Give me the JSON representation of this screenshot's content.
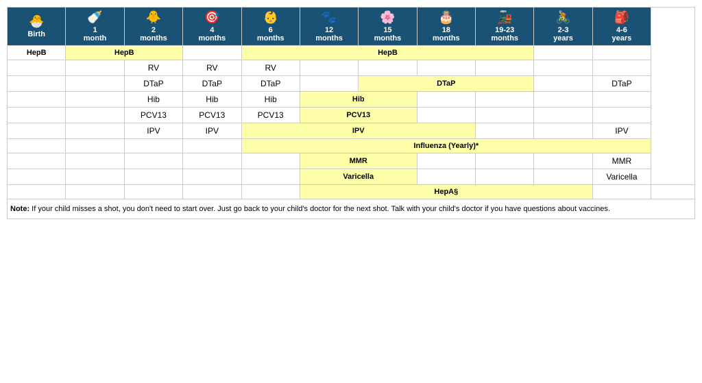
{
  "headers": [
    {
      "id": "birth",
      "label": "Birth",
      "sublabel": "",
      "icon": "🐣"
    },
    {
      "id": "1m",
      "label": "1",
      "sublabel": "month",
      "icon": "🍼"
    },
    {
      "id": "2m",
      "label": "2",
      "sublabel": "months",
      "icon": "🐥"
    },
    {
      "id": "4m",
      "label": "4",
      "sublabel": "months",
      "icon": "🎯"
    },
    {
      "id": "6m",
      "label": "6",
      "sublabel": "months",
      "icon": "👶"
    },
    {
      "id": "12m",
      "label": "12",
      "sublabel": "months",
      "icon": "🐾"
    },
    {
      "id": "15m",
      "label": "15",
      "sublabel": "months",
      "icon": "🌸"
    },
    {
      "id": "18m",
      "label": "18",
      "sublabel": "months",
      "icon": "🎂"
    },
    {
      "id": "19-23m",
      "label": "19-23",
      "sublabel": "months",
      "icon": "🚂"
    },
    {
      "id": "2-3y",
      "label": "2-3",
      "sublabel": "years",
      "icon": "🚴"
    },
    {
      "id": "4-6y",
      "label": "4-6",
      "sublabel": "years",
      "icon": "🎒"
    }
  ],
  "vaccines": [
    {
      "name": "HepB",
      "cells": [
        "yellow",
        "yellow",
        "empty",
        "empty",
        "yellow-span6",
        "empty",
        "empty"
      ]
    }
  ],
  "note": {
    "bold": "Note:",
    "text": " If your child misses a shot, you don't need to start over. Just go back to your child's doctor for the next shot. Talk with your child's doctor if you have questions about vaccines."
  },
  "rows": [
    {
      "label": "HepB",
      "cells": [
        {
          "col": "birth",
          "type": "label",
          "text": "HepB"
        },
        {
          "col": "1m",
          "type": "yellow",
          "text": "HepB",
          "colspan": 2
        },
        {
          "col": "4m",
          "type": "empty",
          "text": ""
        },
        {
          "col": "6m",
          "type": "yellow",
          "text": "HepB",
          "colspan": 5
        },
        {
          "col": "19-23m",
          "type": "empty",
          "text": ""
        },
        {
          "col": "2-3y",
          "type": "empty",
          "text": ""
        },
        {
          "col": "4-6y",
          "type": "empty",
          "text": ""
        }
      ]
    },
    {
      "label": "RV",
      "cells": [
        {
          "col": "birth",
          "type": "empty",
          "text": ""
        },
        {
          "col": "1m",
          "type": "empty",
          "text": ""
        },
        {
          "col": "2m",
          "type": "label-cell",
          "text": "RV"
        },
        {
          "col": "4m",
          "type": "label-cell",
          "text": "RV"
        },
        {
          "col": "6m",
          "type": "label-cell",
          "text": "RV"
        },
        {
          "col": "12m",
          "type": "empty",
          "text": ""
        },
        {
          "col": "15m",
          "type": "empty",
          "text": ""
        },
        {
          "col": "18m",
          "type": "empty",
          "text": ""
        },
        {
          "col": "19-23m",
          "type": "empty",
          "text": ""
        },
        {
          "col": "2-3y",
          "type": "empty",
          "text": ""
        },
        {
          "col": "4-6y",
          "type": "empty",
          "text": ""
        }
      ]
    },
    {
      "label": "DTaP",
      "cells": [
        {
          "col": "birth",
          "type": "empty",
          "text": ""
        },
        {
          "col": "1m",
          "type": "empty",
          "text": ""
        },
        {
          "col": "2m",
          "type": "label-cell",
          "text": "DTaP"
        },
        {
          "col": "4m",
          "type": "label-cell",
          "text": "DTaP"
        },
        {
          "col": "6m",
          "type": "label-cell",
          "text": "DTaP"
        },
        {
          "col": "12m",
          "type": "empty",
          "text": ""
        },
        {
          "col": "15m",
          "type": "yellow",
          "text": "DTaP",
          "colspan": 3
        },
        {
          "col": "19-23m",
          "type": "empty",
          "text": ""
        },
        {
          "col": "2-3y",
          "type": "empty",
          "text": ""
        },
        {
          "col": "4-6y",
          "type": "label-cell",
          "text": "DTaP"
        }
      ]
    },
    {
      "label": "Hib",
      "cells": [
        {
          "col": "birth",
          "type": "empty",
          "text": ""
        },
        {
          "col": "1m",
          "type": "empty",
          "text": ""
        },
        {
          "col": "2m",
          "type": "label-cell",
          "text": "Hib"
        },
        {
          "col": "4m",
          "type": "label-cell",
          "text": "Hib"
        },
        {
          "col": "6m",
          "type": "label-cell",
          "text": "Hib"
        },
        {
          "col": "12m",
          "type": "yellow",
          "text": "Hib",
          "colspan": 2
        },
        {
          "col": "18m",
          "type": "empty",
          "text": ""
        },
        {
          "col": "19-23m",
          "type": "empty",
          "text": ""
        },
        {
          "col": "2-3y",
          "type": "empty",
          "text": ""
        },
        {
          "col": "4-6y",
          "type": "empty",
          "text": ""
        }
      ]
    },
    {
      "label": "PCV13",
      "cells": [
        {
          "col": "birth",
          "type": "empty",
          "text": ""
        },
        {
          "col": "1m",
          "type": "empty",
          "text": ""
        },
        {
          "col": "2m",
          "type": "label-cell",
          "text": "PCV13"
        },
        {
          "col": "4m",
          "type": "label-cell",
          "text": "PCV13"
        },
        {
          "col": "6m",
          "type": "label-cell",
          "text": "PCV13"
        },
        {
          "col": "12m",
          "type": "yellow",
          "text": "PCV13",
          "colspan": 2
        },
        {
          "col": "18m",
          "type": "empty",
          "text": ""
        },
        {
          "col": "19-23m",
          "type": "empty",
          "text": ""
        },
        {
          "col": "2-3y",
          "type": "empty",
          "text": ""
        },
        {
          "col": "4-6y",
          "type": "empty",
          "text": ""
        }
      ]
    },
    {
      "label": "IPV",
      "cells": [
        {
          "col": "birth",
          "type": "empty",
          "text": ""
        },
        {
          "col": "1m",
          "type": "empty",
          "text": ""
        },
        {
          "col": "2m",
          "type": "label-cell",
          "text": "IPV"
        },
        {
          "col": "4m",
          "type": "label-cell",
          "text": "IPV"
        },
        {
          "col": "6m",
          "type": "yellow",
          "text": "IPV",
          "colspan": 4
        },
        {
          "col": "19-23m",
          "type": "empty",
          "text": ""
        },
        {
          "col": "2-3y",
          "type": "empty",
          "text": ""
        },
        {
          "col": "4-6y",
          "type": "label-cell",
          "text": "IPV"
        }
      ]
    },
    {
      "label": "Influenza",
      "cells": [
        {
          "col": "birth",
          "type": "empty",
          "text": ""
        },
        {
          "col": "1m",
          "type": "empty",
          "text": ""
        },
        {
          "col": "2m",
          "type": "empty",
          "text": ""
        },
        {
          "col": "4m",
          "type": "empty",
          "text": ""
        },
        {
          "col": "6m",
          "type": "yellow",
          "text": "Influenza (Yearly)*",
          "colspan": 7
        }
      ]
    },
    {
      "label": "MMR",
      "cells": [
        {
          "col": "birth",
          "type": "empty",
          "text": ""
        },
        {
          "col": "1m",
          "type": "empty",
          "text": ""
        },
        {
          "col": "2m",
          "type": "empty",
          "text": ""
        },
        {
          "col": "4m",
          "type": "empty",
          "text": ""
        },
        {
          "col": "6m",
          "type": "empty",
          "text": ""
        },
        {
          "col": "12m",
          "type": "yellow",
          "text": "MMR",
          "colspan": 2
        },
        {
          "col": "18m",
          "type": "empty",
          "text": ""
        },
        {
          "col": "19-23m",
          "type": "empty",
          "text": ""
        },
        {
          "col": "2-3y",
          "type": "empty",
          "text": ""
        },
        {
          "col": "4-6y",
          "type": "label-cell",
          "text": "MMR"
        }
      ]
    },
    {
      "label": "Varicella",
      "cells": [
        {
          "col": "birth",
          "type": "empty",
          "text": ""
        },
        {
          "col": "1m",
          "type": "empty",
          "text": ""
        },
        {
          "col": "2m",
          "type": "empty",
          "text": ""
        },
        {
          "col": "4m",
          "type": "empty",
          "text": ""
        },
        {
          "col": "6m",
          "type": "empty",
          "text": ""
        },
        {
          "col": "12m",
          "type": "yellow",
          "text": "Varicella",
          "colspan": 2
        },
        {
          "col": "18m",
          "type": "empty",
          "text": ""
        },
        {
          "col": "19-23m",
          "type": "empty",
          "text": ""
        },
        {
          "col": "2-3y",
          "type": "empty",
          "text": ""
        },
        {
          "col": "4-6y",
          "type": "label-cell",
          "text": "Varicella"
        }
      ]
    },
    {
      "label": "HepA",
      "cells": [
        {
          "col": "birth",
          "type": "empty",
          "text": ""
        },
        {
          "col": "1m",
          "type": "empty",
          "text": ""
        },
        {
          "col": "2m",
          "type": "empty",
          "text": ""
        },
        {
          "col": "4m",
          "type": "empty",
          "text": ""
        },
        {
          "col": "6m",
          "type": "empty",
          "text": ""
        },
        {
          "col": "12m",
          "type": "yellow",
          "text": "HepA§",
          "colspan": 6
        },
        {
          "col": "19-23m",
          "type": "yellow-small",
          "text": ""
        },
        {
          "col": "2-3y",
          "type": "empty",
          "text": ""
        },
        {
          "col": "4-6y",
          "type": "empty",
          "text": ""
        }
      ]
    }
  ],
  "icons": {
    "birth": "🐣",
    "1m": "🍼",
    "2m": "🐥",
    "4m": "🎯",
    "6m": "👶",
    "12m": "🐾",
    "15m": "🌸",
    "18m": "🎂",
    "19-23m": "🚂",
    "2-3y": "🚴",
    "4-6y": "🎒"
  }
}
